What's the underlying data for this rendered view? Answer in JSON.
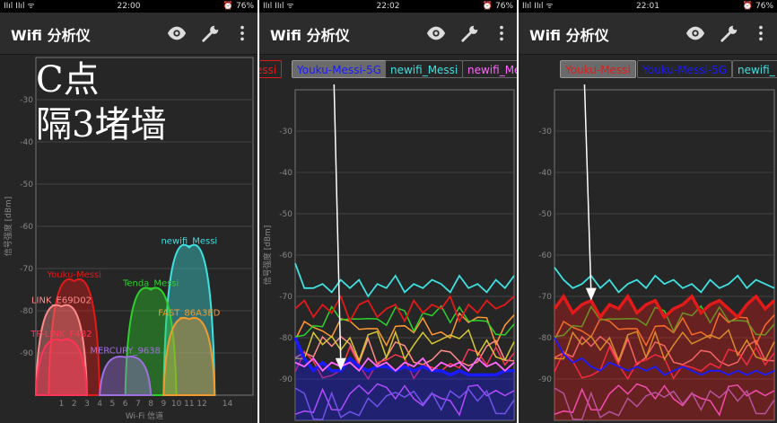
{
  "panels": [
    {
      "status": {
        "left": "ΙΙıl ΙΙıl ᯤ",
        "time": "22:00",
        "right": "⏰ 76%"
      },
      "app_title": "Wifi 分析仪",
      "overlay_note": [
        "C点",
        "隔3堵墙"
      ],
      "y_ticks": [
        "-30",
        "-40",
        "-50",
        "-60",
        "-70",
        "-80",
        "-90"
      ],
      "y_axis_label": "信号强度 [dBm]",
      "x_ticks": [
        "1",
        "2",
        "3",
        "4",
        "5",
        "6",
        "7",
        "8",
        "9",
        "10",
        "11",
        "12",
        "14"
      ],
      "x_axis_label": "Wi-Fi 信道",
      "networks": [
        "newifi_Messi",
        "Youku-Messi",
        "Tenda_Messi",
        "LINK_E69D02",
        "FAST_86A3ED",
        "MERCURY_9638",
        "TP-LINK_F4B2"
      ]
    },
    {
      "status": {
        "left": "ΙΙıl ΙΙıl ᯤ",
        "time": "22:02",
        "right": "⏰ 76%"
      },
      "app_title": "Wifi 分析仪",
      "tabs": [
        "essi",
        "Youku-Messi-5G",
        "newifi_Messi",
        "newifi_Messi_5G"
      ],
      "y_ticks": [
        "-30",
        "-40",
        "-50",
        "-60",
        "-70",
        "-80",
        "-90"
      ],
      "y_axis_label": "信号强度 [dBm]"
    },
    {
      "status": {
        "left": "ΙΙıl ΙΙıl ᯤ",
        "time": "22:01",
        "right": "⏰ 76%"
      },
      "app_title": "Wifi 分析仪",
      "tabs": [
        "Youku-Messi",
        "Youku-Messi-5G",
        "newifi_"
      ],
      "y_ticks": [
        "-30",
        "-40",
        "-50",
        "-60",
        "-70",
        "-80",
        "-90"
      ],
      "y_axis_label": ""
    }
  ],
  "colors": {
    "newifi": "#3fe0e0",
    "youku": "#e31a1a",
    "youku5g": "#1a1aff",
    "tenda": "#2ed02e",
    "fast": "#f09a30",
    "mercury": "#a070e0",
    "link": "#ff8a8a",
    "tplink": "#ff3355",
    "pink": "#ff66ff",
    "orange": "#ff9933",
    "yellow": "#d8c830"
  },
  "chart_data": [
    {
      "type": "area",
      "xlabel": "Wi-Fi 信道",
      "ylabel": "信号强度 [dBm]",
      "ylim": [
        -100,
        -20
      ],
      "x_ticks": [
        1,
        2,
        3,
        4,
        5,
        6,
        7,
        8,
        9,
        10,
        11,
        12,
        14
      ],
      "series": [
        {
          "name": "newifi_Messi",
          "channel": 11,
          "dbm": -65
        },
        {
          "name": "Youku-Messi",
          "channel": 2,
          "dbm": -73
        },
        {
          "name": "Tenda_Messi",
          "channel": 8,
          "dbm": -75
        },
        {
          "name": "LINK_E69D02",
          "channel": 1,
          "dbm": -79
        },
        {
          "name": "FAST_86A3ED",
          "channel": 11,
          "dbm": -82
        },
        {
          "name": "MERCURY_9638",
          "channel": 6,
          "dbm": -91
        },
        {
          "name": "TP-LINK_F4B2",
          "channel": 1,
          "dbm": -87
        }
      ]
    },
    {
      "type": "line",
      "ylabel": "信号强度 [dBm]",
      "ylim": [
        -100,
        -20
      ],
      "series": [
        {
          "name": "newifi_Messi",
          "values": [
            -62,
            -68,
            -68,
            -67,
            -69,
            -66,
            -68,
            -66,
            -70,
            -67,
            -68,
            -65,
            -69,
            -67,
            -68,
            -66,
            -67,
            -69,
            -65,
            -68,
            -67,
            -69,
            -66,
            -68,
            -65
          ]
        },
        {
          "name": "Youku-Messi",
          "values": [
            -73,
            -71,
            -75,
            -72,
            -74,
            -70,
            -76,
            -72,
            -71,
            -75,
            -73,
            -72,
            -76,
            -71,
            -74,
            -72,
            -73,
            -70,
            -76,
            -72,
            -74,
            -71,
            -73,
            -72,
            -70
          ]
        },
        {
          "name": "Youku-Messi-5G",
          "values": [
            -80,
            -85,
            -88,
            -86,
            -88,
            -88,
            -85,
            -87,
            -88,
            -87,
            -87,
            -88,
            -87,
            -88,
            -87,
            -88,
            -88,
            -89,
            -88,
            -89,
            -89,
            -89,
            -89,
            -88,
            -88
          ]
        },
        {
          "name": "newifi_Messi_5G",
          "values": [
            -86,
            -87,
            -85,
            -88,
            -86,
            -87,
            -86,
            -88,
            -85,
            -87,
            -86,
            -88,
            -86,
            -87,
            -85,
            -88,
            -86,
            -87,
            -86,
            -88,
            -85,
            -87,
            -86,
            -88,
            -86
          ]
        }
      ]
    },
    {
      "type": "line",
      "ylabel": "",
      "ylim": [
        -100,
        -20
      ],
      "series": [
        {
          "name": "Youku-Messi",
          "values": [
            -73,
            -70,
            -74,
            -72,
            -71,
            -75,
            -72,
            -73,
            -70,
            -74,
            -72,
            -71,
            -75,
            -73,
            -72,
            -70,
            -74,
            -72,
            -71,
            -73,
            -75,
            -72,
            -70,
            -73,
            -71
          ]
        },
        {
          "name": "Youku-Messi-5G",
          "values": [
            -80,
            -84,
            -86,
            -85,
            -87,
            -88,
            -86,
            -87,
            -88,
            -87,
            -88,
            -87,
            -89,
            -88,
            -87,
            -88,
            -89,
            -88,
            -88,
            -89,
            -88,
            -89,
            -88,
            -89,
            -88
          ]
        },
        {
          "name": "newifi_Messi",
          "values": [
            -63,
            -66,
            -68,
            -67,
            -65,
            -68,
            -66,
            -69,
            -67,
            -66,
            -68,
            -65,
            -67,
            -66,
            -68,
            -67,
            -69,
            -66,
            -68,
            -67,
            -65,
            -68,
            -66,
            -67,
            -68
          ]
        }
      ]
    }
  ]
}
